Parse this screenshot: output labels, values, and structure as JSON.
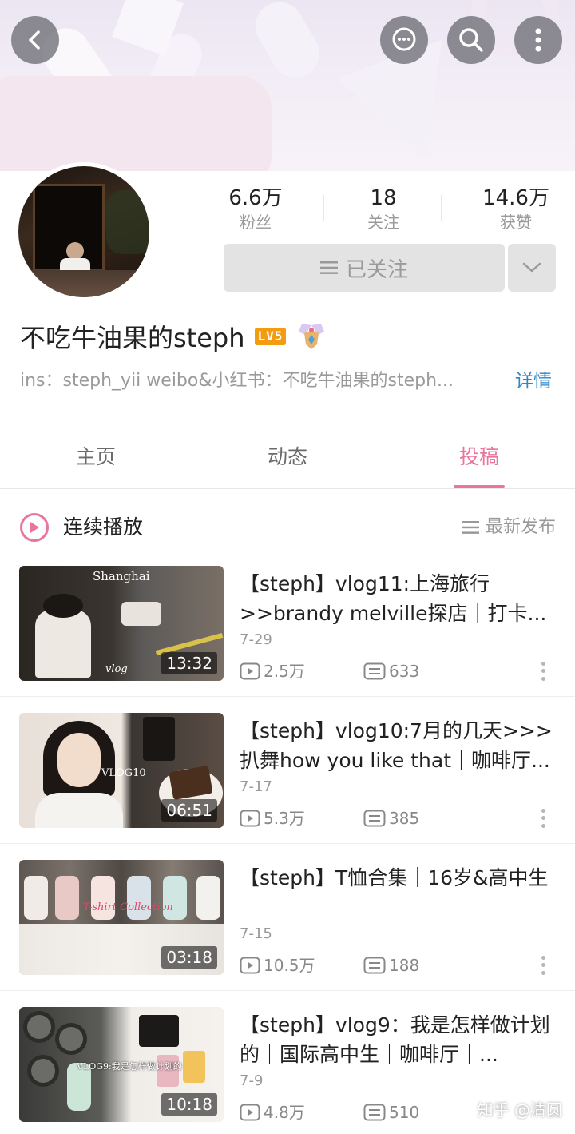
{
  "header": {
    "back_icon": "chevron-left-icon",
    "message_icon": "chat-bubble-icon",
    "search_icon": "search-icon",
    "more_icon": "more-vertical-icon"
  },
  "profile": {
    "stats": [
      {
        "value": "6.6万",
        "label": "粉丝"
      },
      {
        "value": "18",
        "label": "关注"
      },
      {
        "value": "14.6万",
        "label": "获赞"
      }
    ],
    "follow_label": "已关注",
    "username": "不吃牛油果的steph",
    "level": "LV5",
    "bio": "ins：steph_yii weibo&小红书：不吃牛油果的steph...",
    "detail_link": "详情"
  },
  "tabs": [
    {
      "label": "主页",
      "active": false
    },
    {
      "label": "动态",
      "active": false
    },
    {
      "label": "投稿",
      "active": true
    }
  ],
  "playlist": {
    "play_label": "连续播放",
    "sort_label": "最新发布"
  },
  "videos": [
    {
      "title": "【steph】vlog11:上海旅行>>brandy melville探店｜打卡...",
      "date": "7-29",
      "views": "2.5万",
      "comments": "633",
      "duration": "13:32",
      "overlay": "Shanghai",
      "overlay2": "vlog"
    },
    {
      "title": "【steph】vlog10:7月的几天>>>扒舞how you like that｜咖啡厅...",
      "date": "7-17",
      "views": "5.3万",
      "comments": "385",
      "duration": "06:51",
      "overlay": "VLOG10"
    },
    {
      "title": "【steph】T恤合集｜16岁&高中生",
      "date": "7-15",
      "views": "10.5万",
      "comments": "188",
      "duration": "03:18",
      "overlay": "T-shirt Collection"
    },
    {
      "title": "【steph】vlog9：我是怎样做计划的｜国际高中生｜咖啡厅｜...",
      "date": "7-9",
      "views": "4.8万",
      "comments": "510",
      "duration": "10:18",
      "overlay": "VLOG9:我是怎样做计划的"
    }
  ],
  "watermark": "知乎 @清圆",
  "colors": {
    "accent": "#e8759b",
    "link": "#2c86c8",
    "level_badge": "#f39c12"
  }
}
